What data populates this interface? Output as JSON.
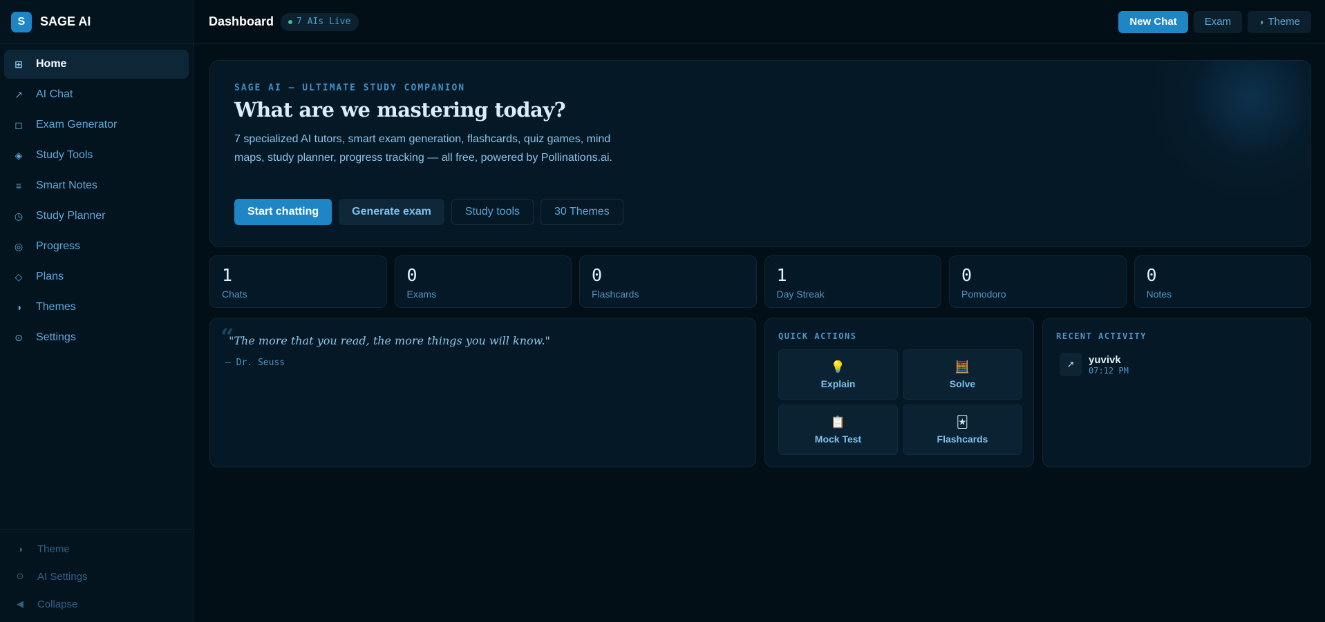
{
  "brand": {
    "logo_letter": "S",
    "name": "SAGE AI"
  },
  "sidebar": {
    "items": [
      {
        "label": "Home",
        "icon": "grid-icon",
        "glyph": "⊞",
        "active": true
      },
      {
        "label": "AI Chat",
        "icon": "arrow-icon",
        "glyph": "↗"
      },
      {
        "label": "Exam Generator",
        "icon": "square-icon",
        "glyph": "◻"
      },
      {
        "label": "Study Tools",
        "icon": "diamond-dot-icon",
        "glyph": "◈"
      },
      {
        "label": "Smart Notes",
        "icon": "lines-icon",
        "glyph": "≡"
      },
      {
        "label": "Study Planner",
        "icon": "clock-icon",
        "glyph": "◷"
      },
      {
        "label": "Progress",
        "icon": "target-icon",
        "glyph": "◎"
      },
      {
        "label": "Plans",
        "icon": "diamond-icon",
        "glyph": "◇"
      },
      {
        "label": "Themes",
        "icon": "half-circle-icon",
        "glyph": "◑"
      },
      {
        "label": "Settings",
        "icon": "dot-circle-icon",
        "glyph": "⊙"
      }
    ],
    "footer": [
      {
        "label": "Theme",
        "icon": "half-circle-icon",
        "glyph": "◑"
      },
      {
        "label": "AI Settings",
        "icon": "dot-circle-icon",
        "glyph": "⊙"
      },
      {
        "label": "Collapse",
        "icon": "triangle-left-icon",
        "glyph": "◀"
      }
    ]
  },
  "topbar": {
    "title": "Dashboard",
    "live_badge": "7 AIs Live",
    "new_chat": "New Chat",
    "exam": "Exam",
    "theme": "Theme",
    "theme_glyph": "◑"
  },
  "hero": {
    "kicker": "SAGE AI — ULTIMATE STUDY COMPANION",
    "title": "What are we mastering today?",
    "description": "7 specialized AI tutors, smart exam generation, flashcards, quiz games, mind maps, study planner, progress tracking — all free, powered by Pollinations.ai.",
    "buttons": {
      "start": "Start chatting",
      "generate": "Generate exam",
      "tools": "Study tools",
      "themes": "30 Themes"
    }
  },
  "stats": [
    {
      "value": "1",
      "label": "Chats"
    },
    {
      "value": "0",
      "label": "Exams"
    },
    {
      "value": "0",
      "label": "Flashcards"
    },
    {
      "value": "1",
      "label": "Day Streak"
    },
    {
      "value": "0",
      "label": "Pomodoro"
    },
    {
      "value": "0",
      "label": "Notes"
    }
  ],
  "quote": {
    "mark": "“",
    "text": "\"The more that you read, the more things you will know.\"",
    "author": "— Dr. Seuss"
  },
  "quick_actions": {
    "title": "QUICK ACTIONS",
    "items": [
      {
        "label": "Explain",
        "icon": "lightbulb-icon",
        "glyph": "💡"
      },
      {
        "label": "Solve",
        "icon": "abacus-icon",
        "glyph": "🧮"
      },
      {
        "label": "Mock Test",
        "icon": "clipboard-icon",
        "glyph": "📋"
      },
      {
        "label": "Flashcards",
        "icon": "cards-icon",
        "glyph": "🃏"
      }
    ]
  },
  "recent_activity": {
    "title": "RECENT ACTIVITY",
    "items": [
      {
        "title": "yuvivk",
        "time": "07:12 PM",
        "icon": "arrow-icon",
        "glyph": "↗"
      }
    ]
  }
}
